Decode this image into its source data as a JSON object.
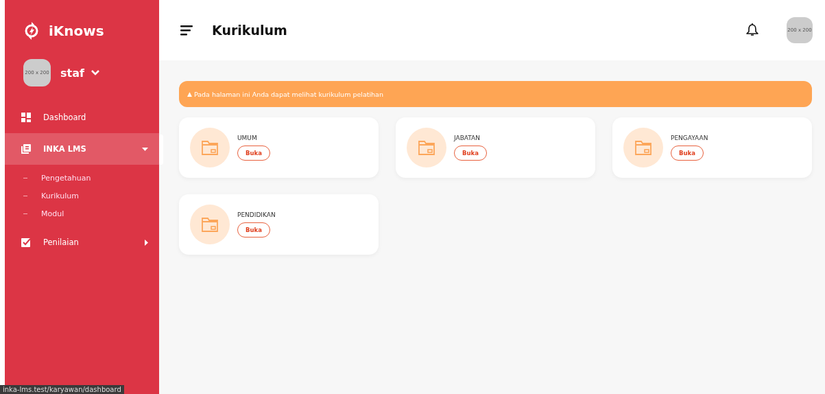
{
  "sidebar": {
    "brand": "iKnows",
    "user": {
      "avatar_text": "200 x 200",
      "name": "staf"
    },
    "items": [
      {
        "kind": "link",
        "label": "Dashboard",
        "selected": false
      },
      {
        "kind": "group",
        "label": "INKA LMS",
        "selected": true,
        "expanded": true,
        "children": [
          {
            "label": "Pengetahuan"
          },
          {
            "label": "Kurikulum"
          },
          {
            "label": "Modul"
          }
        ]
      },
      {
        "kind": "group",
        "label": "Penilaian",
        "selected": false,
        "expanded": false
      }
    ]
  },
  "header": {
    "title": "Kurikulum",
    "avatar_text": "200 x 200"
  },
  "alert": {
    "icon": "▲",
    "text": "Pada halaman ini Anda dapat melihat kurikulum pelatihan"
  },
  "cards": [
    {
      "title": "UMUM",
      "button": "Buka"
    },
    {
      "title": "JABATAN",
      "button": "Buka"
    },
    {
      "title": "PENGAYAAN",
      "button": "Buka"
    },
    {
      "title": "PENDIDIKAN",
      "button": "Buka"
    }
  ],
  "status_bar": {
    "url": "inka-lms.test/karyawan/dashboard"
  }
}
